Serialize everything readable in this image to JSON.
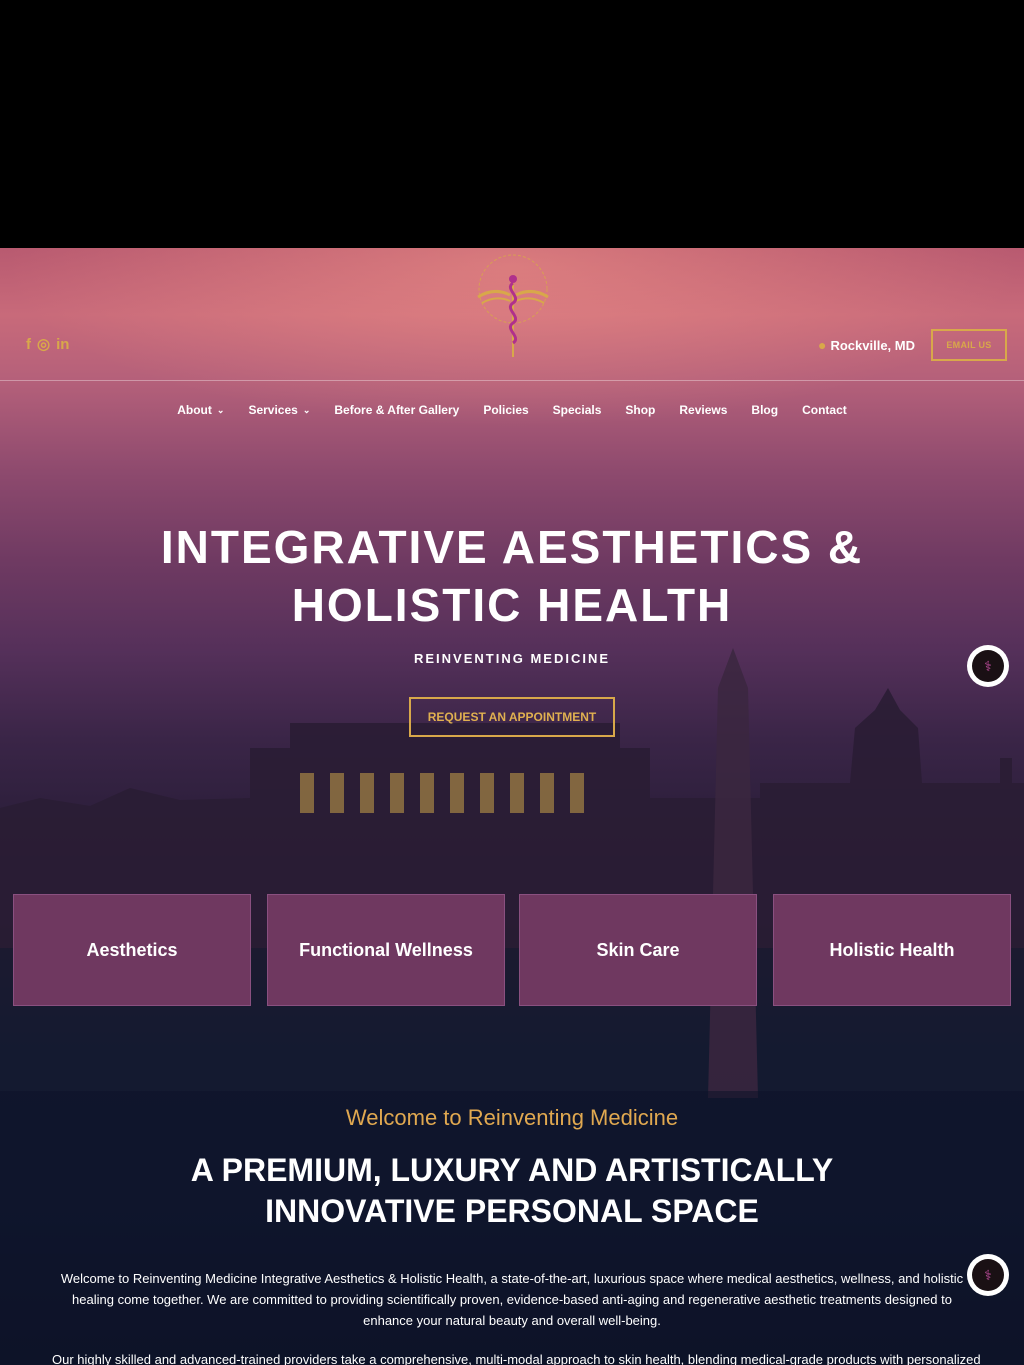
{
  "header": {
    "social_icons": [
      "facebook-icon",
      "instagram-icon",
      "linkedin-icon"
    ],
    "social_glyphs": [
      "f",
      "◎",
      "in"
    ],
    "location_icon": "map-pin-icon",
    "location": "Rockville, MD",
    "email_button": "EMAIL US"
  },
  "nav": {
    "items": [
      {
        "label": "About",
        "has_dropdown": true
      },
      {
        "label": "Services",
        "has_dropdown": true
      },
      {
        "label": "Before & After Gallery",
        "has_dropdown": false
      },
      {
        "label": "Policies",
        "has_dropdown": false
      },
      {
        "label": "Specials",
        "has_dropdown": false
      },
      {
        "label": "Shop",
        "has_dropdown": false
      },
      {
        "label": "Reviews",
        "has_dropdown": false
      },
      {
        "label": "Blog",
        "has_dropdown": false
      },
      {
        "label": "Contact",
        "has_dropdown": false
      }
    ],
    "chevron": "⌄"
  },
  "hero": {
    "title_line1": "INTEGRATIVE AESTHETICS &",
    "title_line2": "HOLISTIC HEALTH",
    "subtitle": "REINVENTING MEDICINE",
    "cta": "REQUEST AN APPOINTMENT"
  },
  "cards": [
    "Aesthetics",
    "Functional Wellness",
    "Skin Care",
    "Holistic Health"
  ],
  "intro": {
    "welcome": "Welcome to Reinventing Medicine",
    "heading_line1": "A PREMIUM, LUXURY AND ARTISTICALLY",
    "heading_line2": "INNOVATIVE PERSONAL SPACE",
    "paragraph1": "Welcome to Reinventing Medicine Integrative Aesthetics & Holistic Health, a state-of-the-art, luxurious space where medical aesthetics, wellness, and holistic healing come together. We are committed to providing scientifically proven, evidence-based anti-aging and regenerative aesthetic treatments designed to enhance your natural beauty and overall well-being.",
    "paragraph2": "Our highly skilled and advanced-trained providers take a comprehensive, multi-modal approach to skin health, blending medical-grade products with personalized"
  },
  "colors": {
    "accent_gold": "#d8a84a",
    "card_purple": "#6f3860"
  }
}
